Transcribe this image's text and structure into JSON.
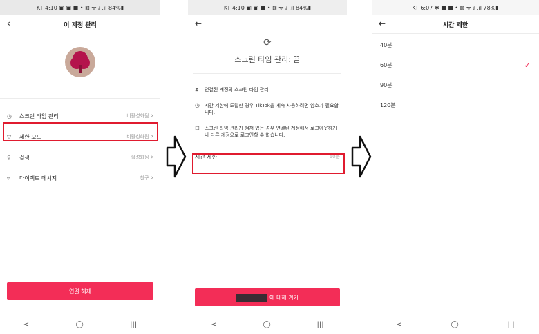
{
  "screens": {
    "account": {
      "status": "KT 4:10 ▣ ▣ ■ •   ⊠ ᯤ ⅈ .ıl 84%▮",
      "title": "이 계정 관리",
      "menu": [
        {
          "label": "스크린 타임 관리",
          "value": "비활성화됨",
          "icon": "clock-icon"
        },
        {
          "label": "제한 모드",
          "value": "비활성화됨",
          "icon": "filter-icon"
        },
        {
          "label": "검색",
          "value": "활성화됨",
          "icon": "search-icon"
        },
        {
          "label": "다이렉트 메시지",
          "value": "친구",
          "icon": "message-icon"
        }
      ],
      "button": "연결 해제"
    },
    "screen_time": {
      "status": "KT 4:10 ▣ ▣ ■ •   ⊠ ᯤ ⅈ .ıl 84%▮",
      "title": "스크린 타임 관리: 끔",
      "items": [
        "연결된 계정의 스크린 타임 관리",
        "시간 제한에 도달한 경우 TikTok을 계속 사용하려면 암호가 필요합니다.",
        "스크린 타임 관리가 켜져 있는 경우 연결된 계정에서 로그아웃하거나 다른 계정으로 로그인할 수 없습니다."
      ],
      "limit_label": "시간 제한",
      "limit_value": "60분",
      "button": "에 대해 켜기"
    },
    "time_limit": {
      "status": "KT 6:07 ✱ ■ ■ •   ⊠ ᯤ ⅈ .ıl 78%▮",
      "title": "시간 제한",
      "options": [
        "40분",
        "60분",
        "90분",
        "120분"
      ],
      "selected": "60분"
    }
  },
  "navbar": {
    "back": "<",
    "home": "◯",
    "recents": "|||"
  },
  "colors": {
    "accent": "#f32d57",
    "highlight": "#e01b2f"
  }
}
